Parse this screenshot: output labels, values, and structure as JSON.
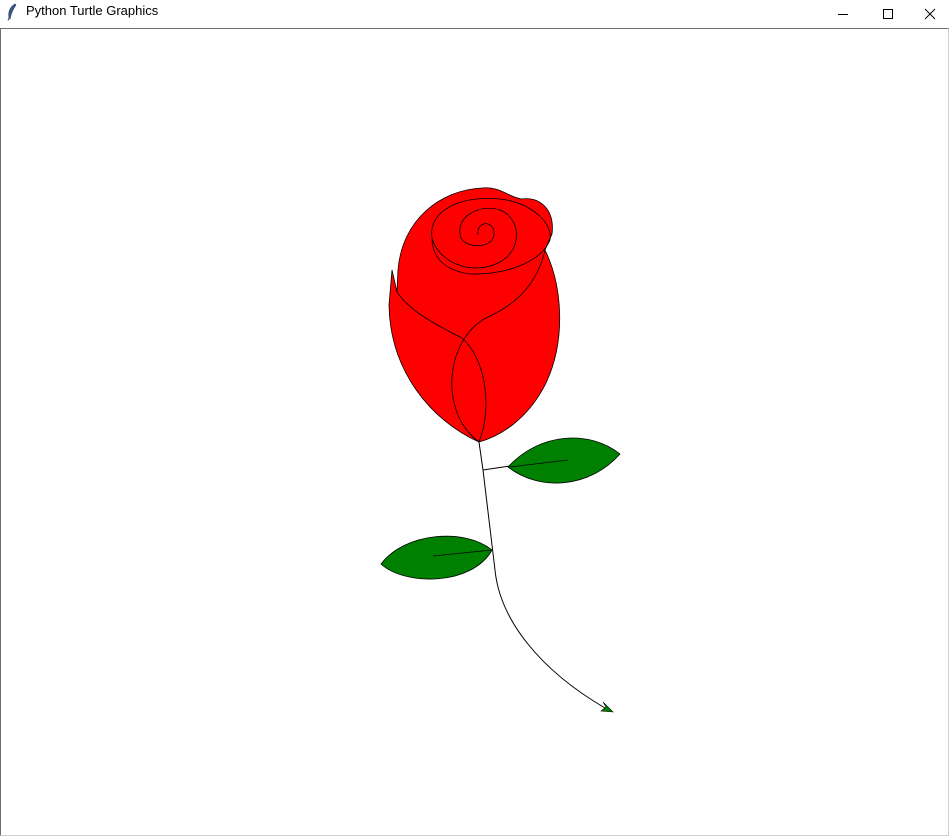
{
  "window": {
    "title": "Python Turtle Graphics",
    "icon": "feather-icon",
    "controls": {
      "minimize": "minimize-icon",
      "maximize": "maximize-icon",
      "close": "close-icon"
    }
  },
  "canvas": {
    "background": "#ffffff",
    "drawing": "rose",
    "colors": {
      "petals": "#ff0000",
      "leaves": "#008000",
      "outline": "#000000",
      "turtle": "#008000"
    }
  }
}
